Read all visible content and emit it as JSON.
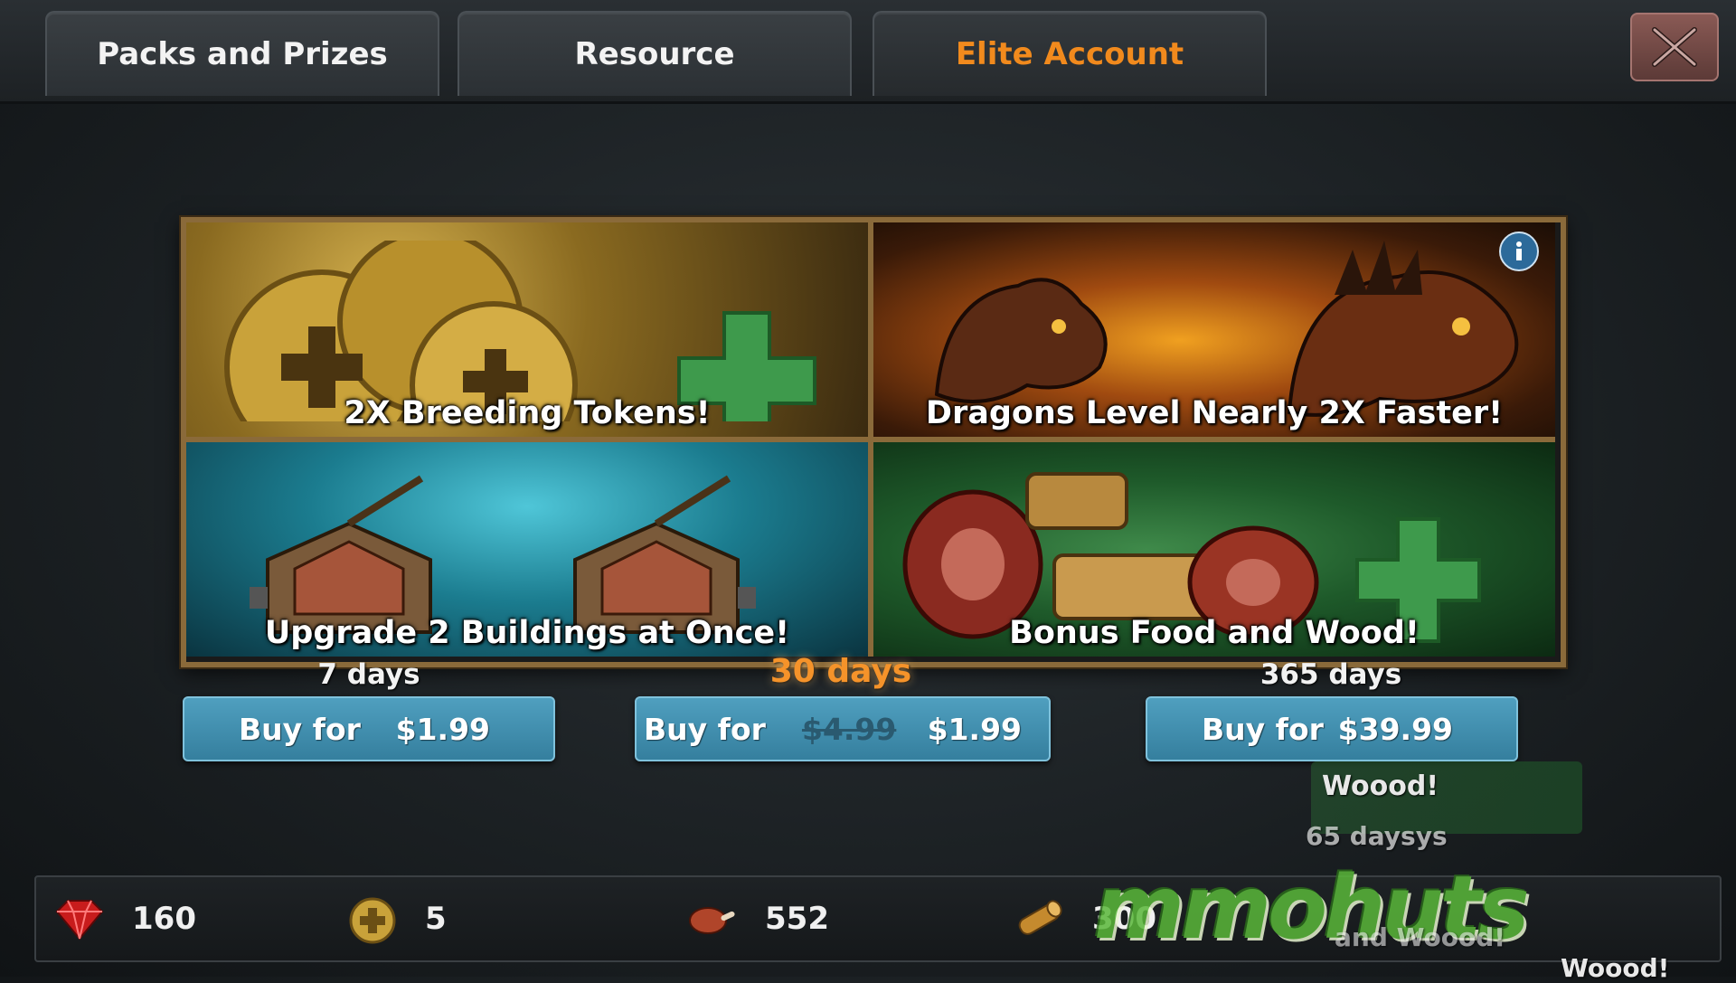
{
  "tabs": [
    {
      "label": "Packs and Prizes",
      "active": false
    },
    {
      "label": "Resource",
      "active": false
    },
    {
      "label": "Elite Account",
      "active": true
    }
  ],
  "panels": [
    {
      "title": "2X Breeding Tokens!"
    },
    {
      "title": "Dragons Level Nearly 2X Faster!"
    },
    {
      "title": "Upgrade 2 Buildings at Once!"
    },
    {
      "title": "Bonus Food and Wood!"
    }
  ],
  "offers": [
    {
      "duration": "7 days",
      "label": "Buy for",
      "price": "$1.99"
    },
    {
      "duration": "30 days",
      "label": "Buy for",
      "old_price": "$4.99",
      "price": "$1.99",
      "highlighted": true
    },
    {
      "duration": "365 days",
      "label": "Buy for",
      "price": "$39.99"
    }
  ],
  "resources": {
    "gems": "160",
    "tokens": "5",
    "food": "552",
    "wood": "300"
  },
  "ghost": {
    "line1": "Woood!",
    "line2": "65 daysys",
    "line3": "and Woood!",
    "line4": "Woood!"
  },
  "watermark": "mmohuts",
  "colors": {
    "active_tab": "#f18a1d",
    "buy_button": "#4396b6",
    "frame": "#8a6a3a"
  },
  "icons": [
    "close-icon",
    "info-icon",
    "gem-icon",
    "token-icon",
    "food-icon",
    "wood-icon"
  ]
}
